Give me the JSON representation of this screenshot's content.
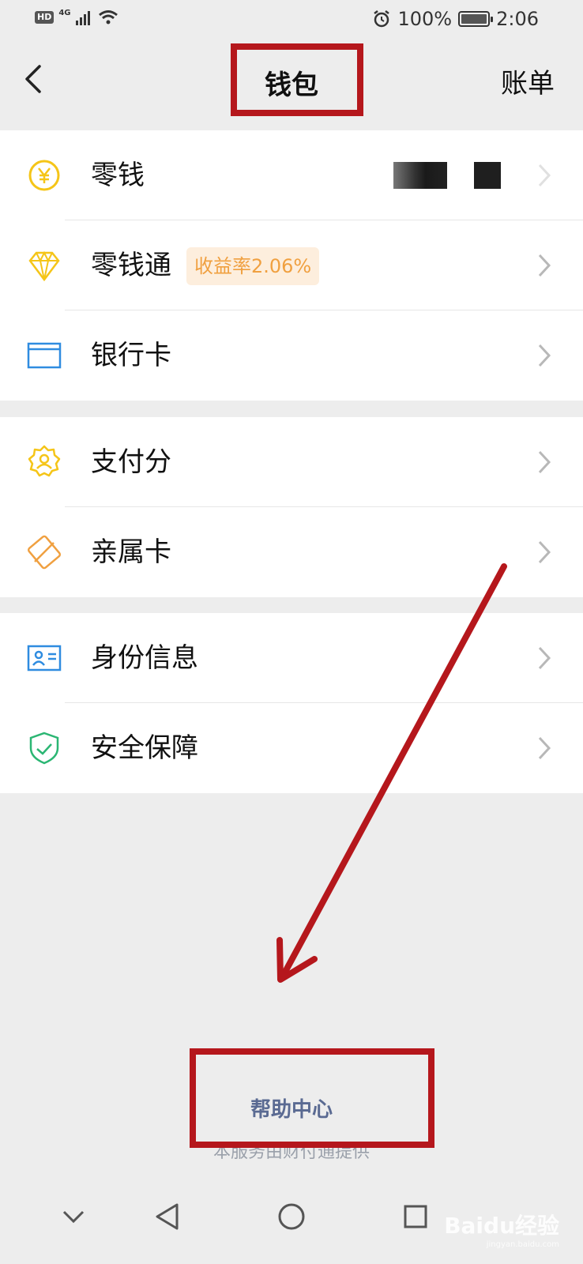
{
  "status_bar": {
    "hd": "HD",
    "network": "4G",
    "battery_percent": "100%",
    "time": "2:06",
    "battery_level": 1.0
  },
  "nav": {
    "title": "钱包",
    "right_label": "账单",
    "back_icon": "chevron-left-icon"
  },
  "groups": [
    {
      "items": [
        {
          "label": "零钱",
          "icon": "yuan-coin-icon",
          "icon_color": "#f5c518",
          "value_masked": true
        },
        {
          "label": "零钱通",
          "icon": "diamond-icon",
          "icon_color": "#f5c518",
          "badge": "收益率2.06%"
        },
        {
          "label": "银行卡",
          "icon": "bank-card-icon",
          "icon_color": "#2f8ce0"
        }
      ]
    },
    {
      "items": [
        {
          "label": "支付分",
          "icon": "badge-person-icon",
          "icon_color": "#f5c518"
        },
        {
          "label": "亲属卡",
          "icon": "family-card-icon",
          "icon_color": "#f0a040"
        }
      ]
    },
    {
      "items": [
        {
          "label": "身份信息",
          "icon": "id-card-icon",
          "icon_color": "#2f8ce0"
        },
        {
          "label": "安全保障",
          "icon": "shield-check-icon",
          "icon_color": "#2bb673"
        }
      ]
    }
  ],
  "footer": {
    "help_center": "帮助中心",
    "provider": "本服务由财付通提供"
  },
  "watermark": {
    "text": "Baidu经验",
    "subtext": "jingyan.baidu.com"
  },
  "annotation_color": "#b5171c"
}
